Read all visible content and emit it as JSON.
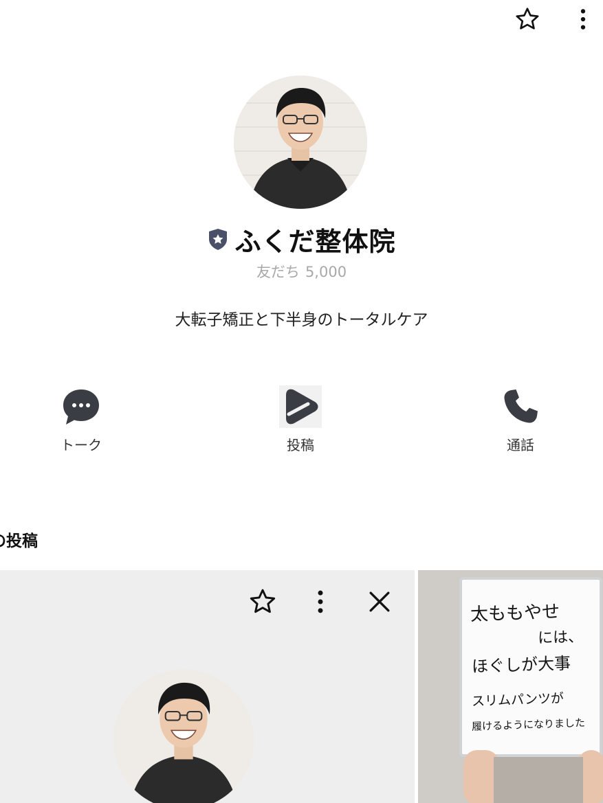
{
  "header": {
    "favorite_icon": "star-outline-icon",
    "more_icon": "more-vertical-icon"
  },
  "profile": {
    "badge_icon": "verified-shield-icon",
    "name": "ふくだ整体院",
    "friends_label": "友だち",
    "friends_count": "5,000",
    "description": "大転子矯正と下半身のトータルケア"
  },
  "actions": [
    {
      "label": "トーク",
      "icon": "chat-bubble-icon"
    },
    {
      "label": "投稿",
      "icon": "post-play-icon"
    },
    {
      "label": "通話",
      "icon": "phone-icon"
    }
  ],
  "posts_section": {
    "title": "の投稿",
    "posts": [
      {
        "type": "screenshot",
        "icons": [
          "star-outline-icon",
          "more-vertical-icon",
          "close-icon"
        ]
      },
      {
        "type": "photo",
        "board_lines": [
          "太ももやせ",
          "には、",
          "ほぐしが大事",
          "スリムパンツが",
          "履けるようになりました"
        ]
      }
    ]
  },
  "colors": {
    "icon_dark": "#3b3d45",
    "badge": "#4a5068",
    "muted_text": "#a8a8a8",
    "post_bg": "#eeeeee"
  }
}
